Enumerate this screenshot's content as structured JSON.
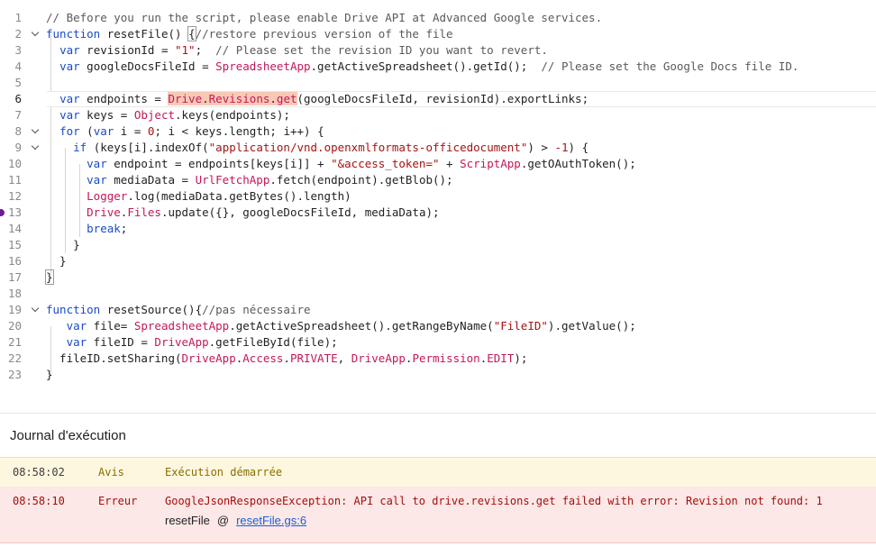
{
  "editor": {
    "lines": [
      {
        "n": "1",
        "html": "<span class=\"c\">// Before you run the script, please enable Drive API at Advanced Google services.</span>"
      },
      {
        "n": "2",
        "fold": true,
        "html": "<span class=\"k\">function</span> resetFile() <span class=\"bracket\">{</span><span class=\"c\">//restore previous version of the file</span>"
      },
      {
        "n": "3",
        "html": "  <span class=\"k\">var</span> revisionId = <span class=\"s\">\"1\"</span>;  <span class=\"c\">// Please set the revision ID you want to revert.</span>"
      },
      {
        "n": "4",
        "html": "  <span class=\"k\">var</span> googleDocsFileId = <span class=\"cls\">SpreadsheetApp</span>.getActiveSpreadsheet().getId();  <span class=\"c\">// Please set the Google Docs file ID.</span>"
      },
      {
        "n": "5",
        "html": ""
      },
      {
        "n": "6",
        "current": true,
        "html": "  <span class=\"k\">var</span> endpoints = <span class=\"hl\"><span class=\"cls\">Drive</span>.<span class=\"cls\">Revisions</span>.<span class=\"cls\">get</span></span>(googleDocsFileId, revisionId).exportLinks;"
      },
      {
        "n": "7",
        "html": "  <span class=\"k\">var</span> keys = <span class=\"cls\">Object</span>.keys(endpoints);"
      },
      {
        "n": "8",
        "fold": true,
        "html": "  <span class=\"k\">for</span> (<span class=\"k\">var</span> i = <span class=\"s\">0</span>; i &lt; keys.length; i++) {"
      },
      {
        "n": "9",
        "fold": true,
        "html": "    <span class=\"k\">if</span> (keys[i].indexOf(<span class=\"s\">\"application/vnd.openxmlformats-officedocument\"</span>) &gt; <span class=\"s\">-1</span>) {"
      },
      {
        "n": "10",
        "html": "      <span class=\"k\">var</span> endpoint = endpoints[keys[i]] + <span class=\"s\">\"&amp;access_token=\"</span> + <span class=\"cls\">ScriptApp</span>.getOAuthToken();"
      },
      {
        "n": "11",
        "html": "      <span class=\"k\">var</span> mediaData = <span class=\"cls\">UrlFetchApp</span>.fetch(endpoint).getBlob();"
      },
      {
        "n": "12",
        "html": "      <span class=\"cls\">Logger</span>.log(mediaData.getBytes().length)"
      },
      {
        "n": "13",
        "bp": true,
        "html": "      <span class=\"cls\">Drive</span>.<span class=\"cls\">Files</span>.update({}, googleDocsFileId, mediaData);"
      },
      {
        "n": "14",
        "html": "      <span class=\"k\">break</span>;"
      },
      {
        "n": "15",
        "html": "    }"
      },
      {
        "n": "16",
        "html": "  }"
      },
      {
        "n": "17",
        "html": "<span class=\"bracket\">}</span>"
      },
      {
        "n": "18",
        "html": ""
      },
      {
        "n": "19",
        "fold": true,
        "html": "<span class=\"k\">function</span> resetSource(){<span class=\"c\">//pas nécessaire</span>"
      },
      {
        "n": "20",
        "html": "   <span class=\"k\">var</span> file= <span class=\"cls\">SpreadsheetApp</span>.getActiveSpreadsheet().getRangeByName(<span class=\"s\">\"FileID\"</span>).getValue();"
      },
      {
        "n": "21",
        "html": "   <span class=\"k\">var</span> fileID = <span class=\"cls\">DriveApp</span>.getFileById(file);"
      },
      {
        "n": "22",
        "html": "  fileID.setSharing(<span class=\"cls\">DriveApp</span>.<span class=\"cls\">Access</span>.<span class=\"cls\">PRIVATE</span>, <span class=\"cls\">DriveApp</span>.<span class=\"cls\">Permission</span>.<span class=\"cls\">EDIT</span>);"
      },
      {
        "n": "23",
        "html": "}"
      }
    ]
  },
  "panel": {
    "title": "Journal d'exécution",
    "info": {
      "time": "08:58:02",
      "level": "Avis",
      "message": "Exécution démarrée"
    },
    "error": {
      "time": "08:58:10",
      "level": "Erreur",
      "message": "GoogleJsonResponseException: API call to drive.revisions.get failed with error: Revision not found: 1",
      "trace_fn": "resetFile",
      "trace_at": "@",
      "trace_link": "resetFile.gs:6"
    }
  },
  "colors": {
    "keyword": "#1a4ac8",
    "string": "#a31515",
    "class": "#c2185b",
    "highlight": "#f8c9b6",
    "warn_bg": "#fef7e0",
    "error_bg": "#fce8e6",
    "breakpoint": "#6a1b9a"
  }
}
